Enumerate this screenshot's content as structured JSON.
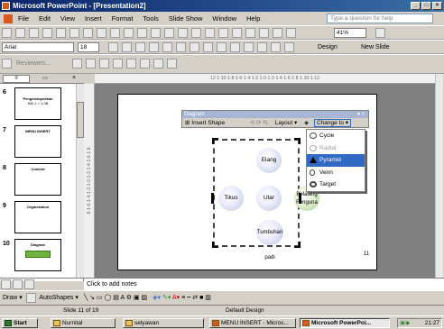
{
  "window": {
    "title": "Microsoft PowerPoint - [Presentation2]"
  },
  "menu": [
    "File",
    "Edit",
    "View",
    "Insert",
    "Format",
    "Tools",
    "Slide Show",
    "Window",
    "Help"
  ],
  "ask_placeholder": "Type a question for help",
  "toolbar": {
    "zoom": "41%",
    "font": "Arial",
    "size": "18",
    "design_label": "Design",
    "new_slide_label": "New Slide",
    "reviewers_label": "Reviewers..."
  },
  "ruler": {
    "horizontal": "·12·1·10·1·8·1·6·1·4·1·2·1·0·1·2·1·4·1·6·1·8·1·10·1·12·",
    "vertical": "·8·1·6·1·4·1·2·1·0·1·2·1·4·1·6·1·8·"
  },
  "thumbnails": [
    {
      "num": "6",
      "title": "Pengelompokkan",
      "body": "Klik 1 = 1,3B"
    },
    {
      "num": "7",
      "title": "MENU INSERT",
      "body": ""
    },
    {
      "num": "8",
      "title": "Content",
      "body": ""
    },
    {
      "num": "9",
      "title": "Organization",
      "body": ""
    },
    {
      "num": "10",
      "title": "Diagram",
      "body": ""
    }
  ],
  "diagram_toolbar": {
    "title": "Diagram",
    "insert_shape": "Insert Shape",
    "layout": "Layout",
    "change_to": "Change to"
  },
  "change_to_menu": [
    {
      "label": "Cycle",
      "state": "normal"
    },
    {
      "label": "Radial",
      "state": "disabled"
    },
    {
      "label": "Pyramid",
      "state": "selected"
    },
    {
      "label": "Venn",
      "state": "normal"
    },
    {
      "label": "Target",
      "state": "normal"
    }
  ],
  "diagram": {
    "top": "Elang",
    "left": "Tikus",
    "center": "Ular",
    "right": "Belalang Fenguna",
    "bottom": "Tumbuhan padi"
  },
  "slide_number": "11",
  "notes_placeholder": "Click to add notes",
  "draw_toolbar": {
    "draw": "Draw",
    "autoshapes": "AutoShapes"
  },
  "status": {
    "slide": "Slide 11 of 19",
    "design": "Default Design"
  },
  "taskbar": {
    "start": "Start",
    "tasks": [
      "Nurnital",
      "selyawan",
      "MENU INSERT - Micros...",
      "Microsoft PowerPoi..."
    ],
    "clock": "21:27"
  }
}
